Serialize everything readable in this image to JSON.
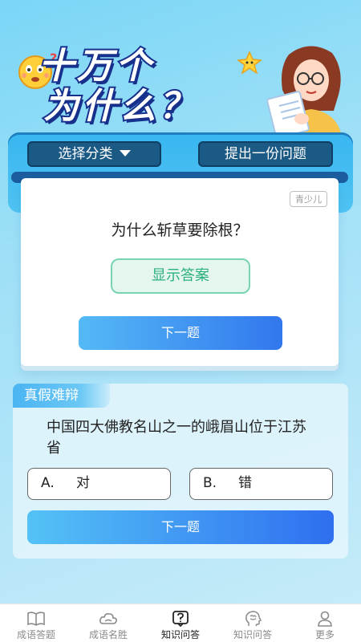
{
  "hero": {
    "title_line1": "十万个",
    "title_line2": "为什么？"
  },
  "toolbar": {
    "category_label": "选择分类",
    "ask_label": "提出一份问题"
  },
  "quiz": {
    "tag": "青少儿",
    "question": "为什么斩草要除根？",
    "show_answer_label": "显示答案",
    "next_label": "下一题"
  },
  "true_false": {
    "section_label": "真假难辩",
    "question": "中国四大佛教名山之一的峨眉山位于江苏省",
    "options": [
      {
        "letter": "A.",
        "text": "对"
      },
      {
        "letter": "B.",
        "text": "错"
      }
    ],
    "next_label": "下一题"
  },
  "tabbar": {
    "items": [
      {
        "label": "成语答题",
        "icon": "book-icon",
        "active": false
      },
      {
        "label": "成语名胜",
        "icon": "cloud-icon",
        "active": false
      },
      {
        "label": "知识问答",
        "icon": "question-box-icon",
        "active": true
      },
      {
        "label": "知识问答",
        "icon": "brain-head-icon",
        "active": false
      },
      {
        "label": "更多",
        "icon": "person-icon",
        "active": false
      }
    ]
  },
  "colors": {
    "accent_blue": "#3177ee",
    "answer_green": "#2bb07c",
    "pill_dark": "#1c5a86"
  }
}
